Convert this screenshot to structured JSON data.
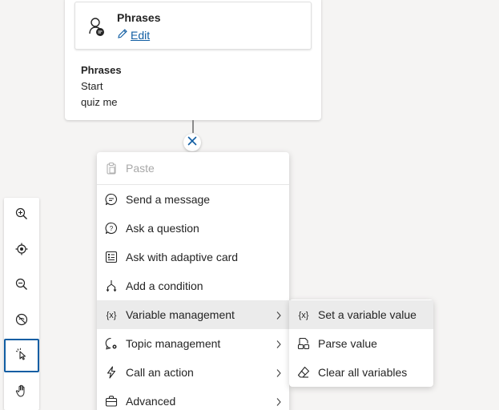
{
  "trigger": {
    "title": "Phrases",
    "edit_label": "Edit",
    "phrases_heading": "Phrases",
    "phrases": [
      "Start",
      "quiz me"
    ]
  },
  "toolbar": {
    "items": [
      {
        "name": "zoom-in",
        "icon": "zoom-in-icon"
      },
      {
        "name": "fit-view",
        "icon": "target-icon"
      },
      {
        "name": "zoom-out",
        "icon": "zoom-out-icon"
      },
      {
        "name": "minimap-toggle",
        "icon": "no-eye-icon"
      },
      {
        "name": "select-tool",
        "icon": "pointer-icon",
        "active": true
      },
      {
        "name": "pan-tool",
        "icon": "hand-icon"
      }
    ]
  },
  "menu": {
    "items": [
      {
        "label": "Paste",
        "icon": "clipboard-icon",
        "disabled": true
      },
      {
        "label": "Send a message",
        "icon": "chat-icon"
      },
      {
        "label": "Ask a question",
        "icon": "question-icon"
      },
      {
        "label": "Ask with adaptive card",
        "icon": "card-icon"
      },
      {
        "label": "Add a condition",
        "icon": "branch-icon"
      },
      {
        "label": "Variable management",
        "icon": "variable-icon",
        "submenu": true,
        "highlighted": true
      },
      {
        "label": "Topic management",
        "icon": "topic-icon",
        "submenu": true
      },
      {
        "label": "Call an action",
        "icon": "lightning-icon",
        "submenu": true
      },
      {
        "label": "Advanced",
        "icon": "briefcase-icon",
        "submenu": true
      }
    ]
  },
  "submenu": {
    "items": [
      {
        "label": "Set a variable value",
        "icon": "variable-icon",
        "highlighted": true
      },
      {
        "label": "Parse value",
        "icon": "parse-icon"
      },
      {
        "label": "Clear all variables",
        "icon": "eraser-icon"
      }
    ]
  },
  "colors": {
    "accent": "#115ea3",
    "canvas": "#f5f4f3",
    "hover": "#ebebeb"
  }
}
